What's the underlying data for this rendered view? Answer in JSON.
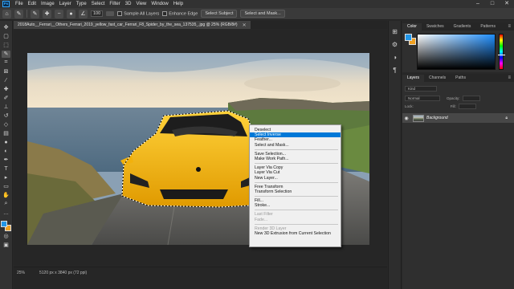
{
  "app": {
    "logo": "Ps"
  },
  "menubar": {
    "items": [
      "File",
      "Edit",
      "Image",
      "Layer",
      "Type",
      "Select",
      "Filter",
      "3D",
      "View",
      "Window",
      "Help"
    ]
  },
  "window_controls": [
    "–",
    "□",
    "✕"
  ],
  "options": {
    "size_value": "100",
    "sample_all_layers": "Sample All Layers",
    "enhance_edge": "Enhance Edge",
    "select_subject": "Select Subject",
    "select_and_mask": "Select and Mask..."
  },
  "document": {
    "tab_title": "2018Auto__Ferrari__Others_Ferrari_2019_yellow_fast_car_Ferrari_F8_Spider_by_the_sea_137535_.jpg @ 25% (RGB/8#)"
  },
  "status": {
    "zoom": "25%",
    "size": "5120 px x 3840 px (72 ppi)"
  },
  "context_menu": {
    "items": [
      {
        "label": "Deselect",
        "state": "normal"
      },
      {
        "label": "Select Inverse",
        "state": "highlighted"
      },
      {
        "label": "Feather...",
        "state": "normal"
      },
      {
        "label": "Select and Mask...",
        "state": "normal"
      },
      {
        "sep": true
      },
      {
        "label": "Save Selection...",
        "state": "normal"
      },
      {
        "label": "Make Work Path...",
        "state": "normal"
      },
      {
        "sep": true
      },
      {
        "label": "Layer Via Copy",
        "state": "normal"
      },
      {
        "label": "Layer Via Cut",
        "state": "normal"
      },
      {
        "label": "New Layer...",
        "state": "normal"
      },
      {
        "sep": true
      },
      {
        "label": "Free Transform",
        "state": "normal"
      },
      {
        "label": "Transform Selection",
        "state": "normal"
      },
      {
        "sep": true
      },
      {
        "label": "Fill...",
        "state": "normal"
      },
      {
        "label": "Stroke...",
        "state": "normal"
      },
      {
        "sep": true
      },
      {
        "label": "Last Filter",
        "state": "disabled"
      },
      {
        "label": "Fade...",
        "state": "disabled"
      },
      {
        "sep": true
      },
      {
        "label": "Render 3D Layer",
        "state": "disabled"
      },
      {
        "label": "New 3D Extrusion from Current Selection",
        "state": "normal"
      }
    ]
  },
  "color_panel": {
    "tabs": [
      "Color",
      "Swatches",
      "Gradients",
      "Patterns"
    ],
    "foreground": "#2196e8",
    "background": "#f0a020"
  },
  "layers_panel": {
    "tabs": [
      "Layers",
      "Channels",
      "Paths"
    ],
    "kind": "Kind",
    "blend_mode": "Normal",
    "opacity_label": "Opacity:",
    "lock_label": "Lock:",
    "fill_label": "Fill:",
    "layer_name": "Background"
  }
}
